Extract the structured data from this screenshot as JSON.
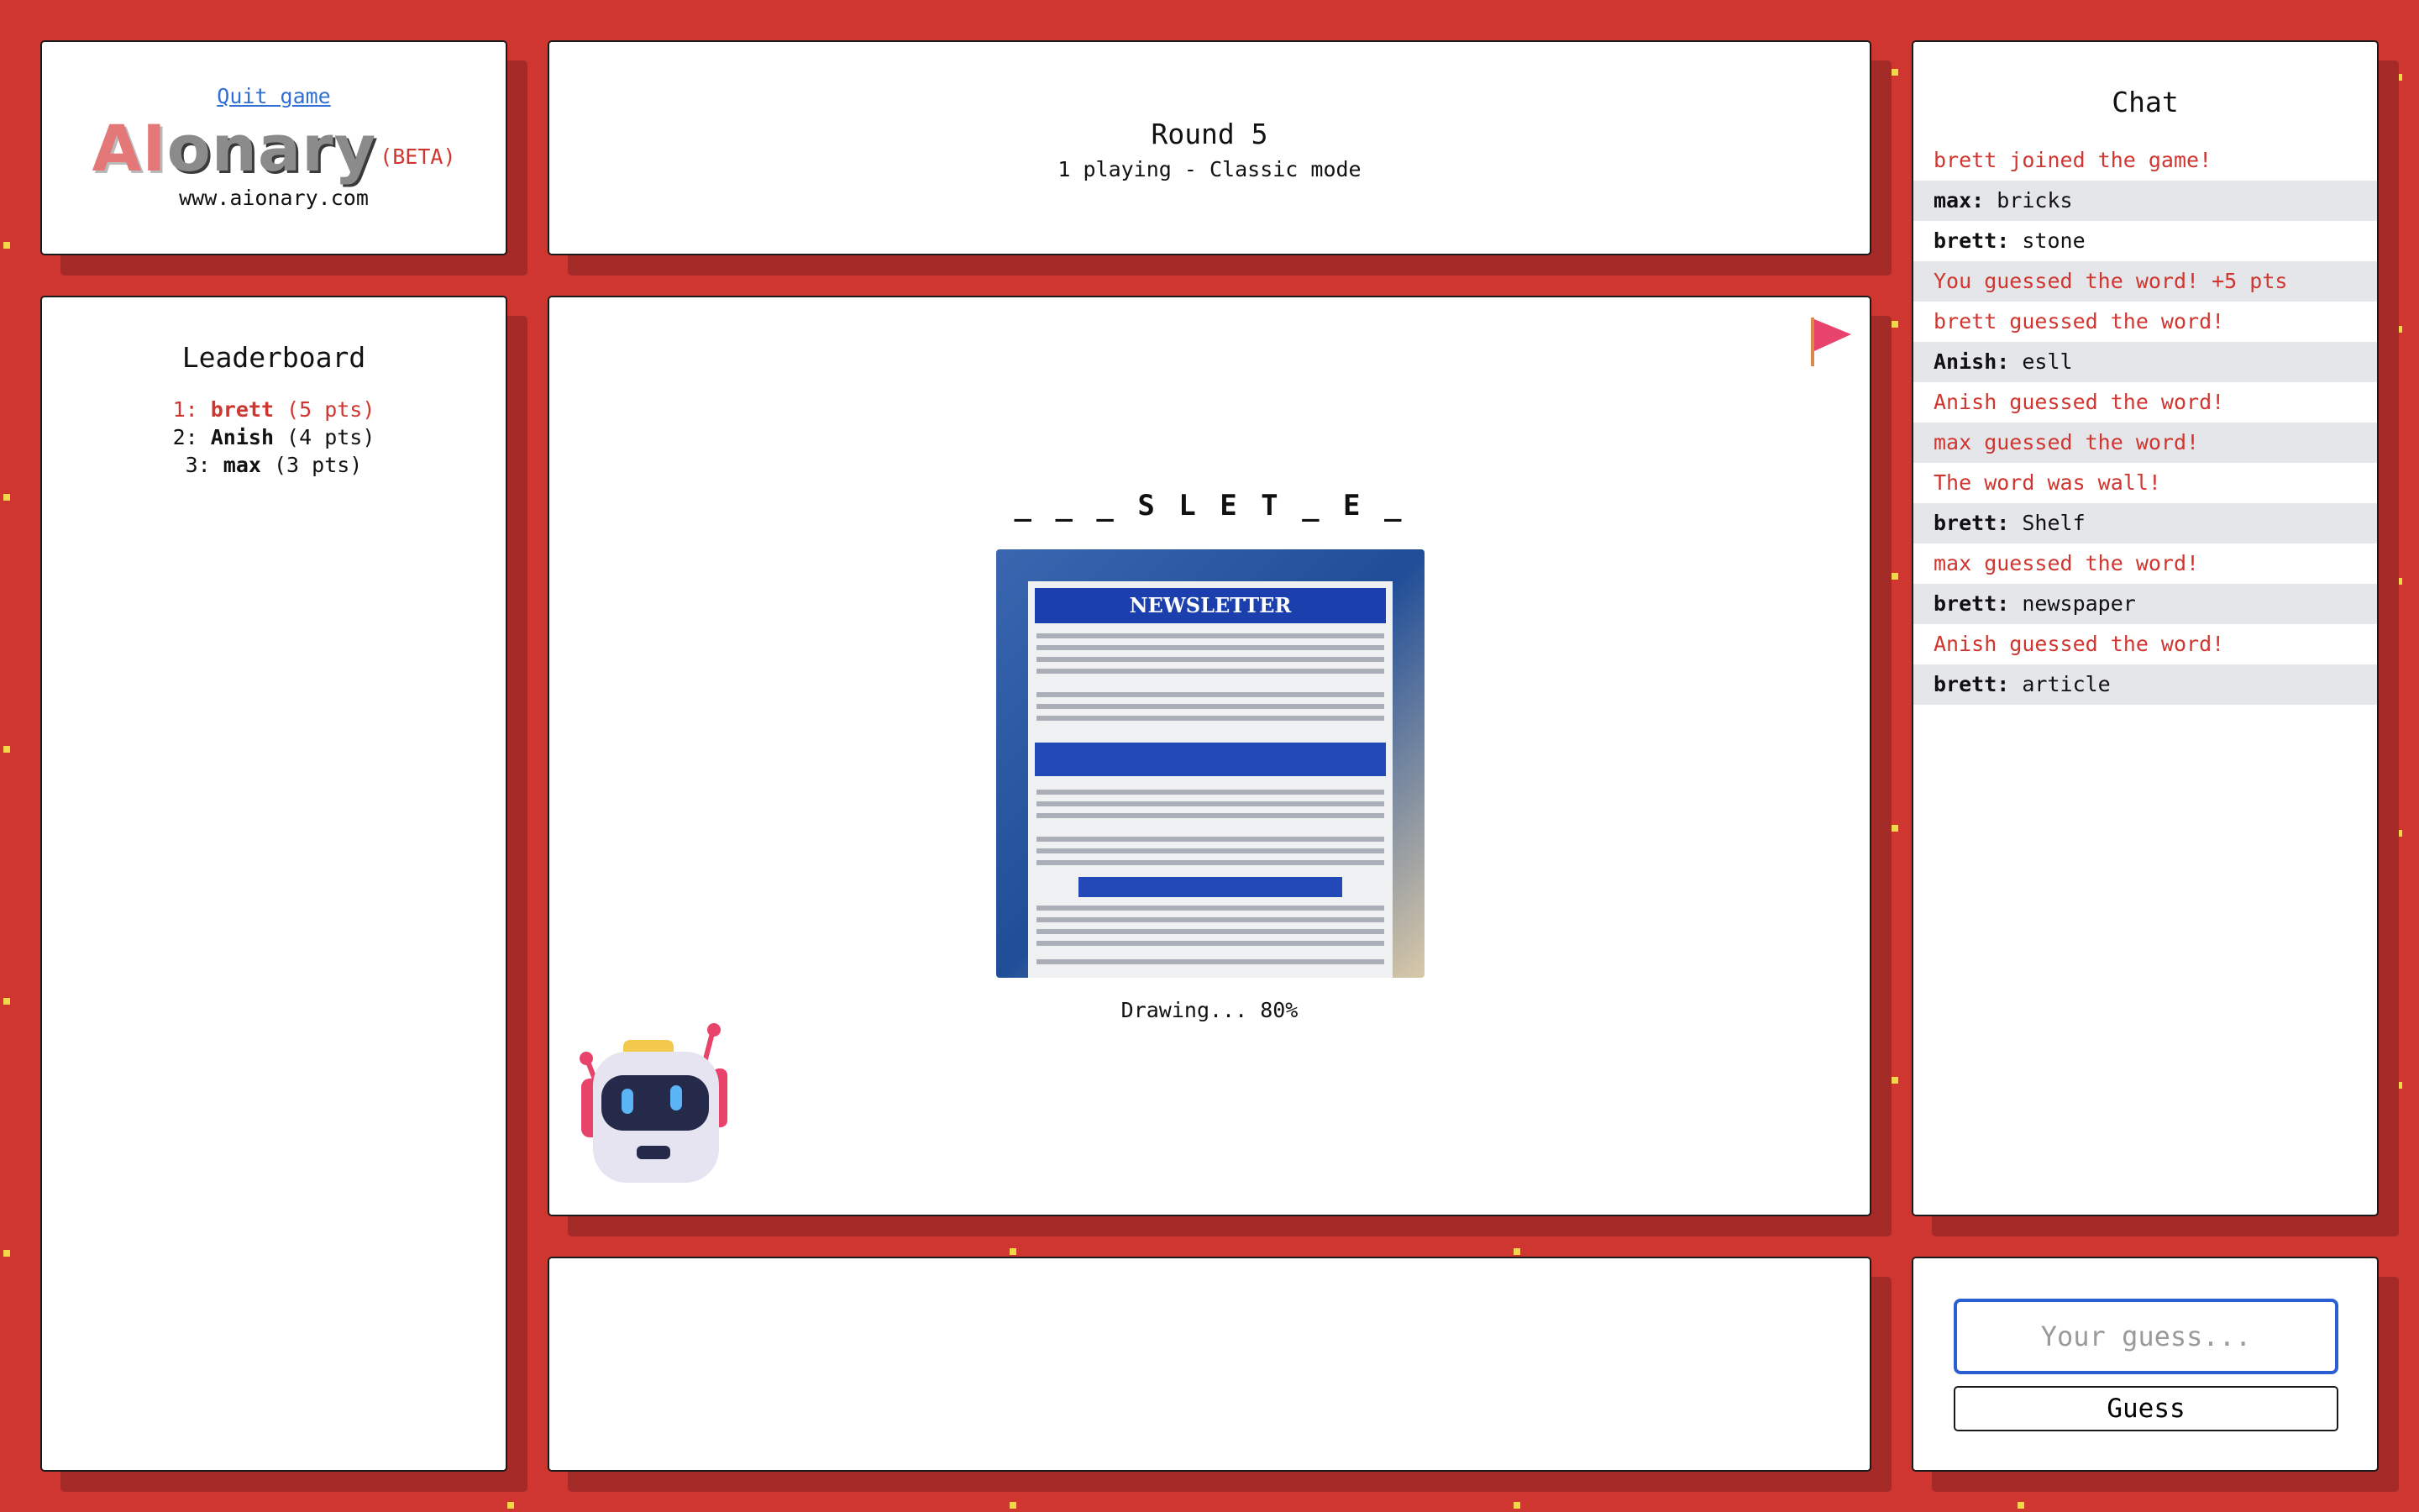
{
  "header": {
    "quit_label": "Quit game",
    "logo_ai": "AI",
    "logo_rest": "onary",
    "beta_label": "(BETA)",
    "site_url": "www.aionary.com"
  },
  "round": {
    "title": "Round 5",
    "subtitle": "1 playing - Classic mode"
  },
  "leaderboard": {
    "title": "Leaderboard",
    "entries": [
      {
        "rank": "1: ",
        "name": "brett",
        "points": " (5 pts)"
      },
      {
        "rank": "2: ",
        "name": "Anish",
        "points": " (4 pts)"
      },
      {
        "rank": "3: ",
        "name": "max",
        "points": " (3 pts)"
      }
    ]
  },
  "drawing": {
    "hint": "_ _ _ S L E T _ E _",
    "newsletter_heading": "NEWSLETTER",
    "progress": "Drawing... 80%"
  },
  "chat": {
    "title": "Chat",
    "messages": [
      {
        "user": "",
        "text": "brett joined the game!"
      },
      {
        "user": "max:",
        "text": " bricks"
      },
      {
        "user": "brett:",
        "text": " stone"
      },
      {
        "user": "",
        "text": "You guessed the word! +5 pts"
      },
      {
        "user": "",
        "text": "brett guessed the word!"
      },
      {
        "user": "Anish:",
        "text": " esll"
      },
      {
        "user": "",
        "text": "Anish guessed the word!"
      },
      {
        "user": "",
        "text": "max guessed the word!"
      },
      {
        "user": "",
        "text": "The word was wall!"
      },
      {
        "user": "brett:",
        "text": " Shelf"
      },
      {
        "user": "",
        "text": "max guessed the word!"
      },
      {
        "user": "brett:",
        "text": " newspaper"
      },
      {
        "user": "",
        "text": "Anish guessed the word!"
      },
      {
        "user": "brett:",
        "text": " article"
      }
    ]
  },
  "guess": {
    "placeholder": "Your guess...",
    "button_label": "Guess"
  },
  "icons": {
    "flag": "report-flag-icon",
    "robot": "robot-mascot-icon"
  },
  "colors": {
    "background": "#cf3630",
    "accent": "#cf3630",
    "input_border": "#2a5fd3"
  }
}
